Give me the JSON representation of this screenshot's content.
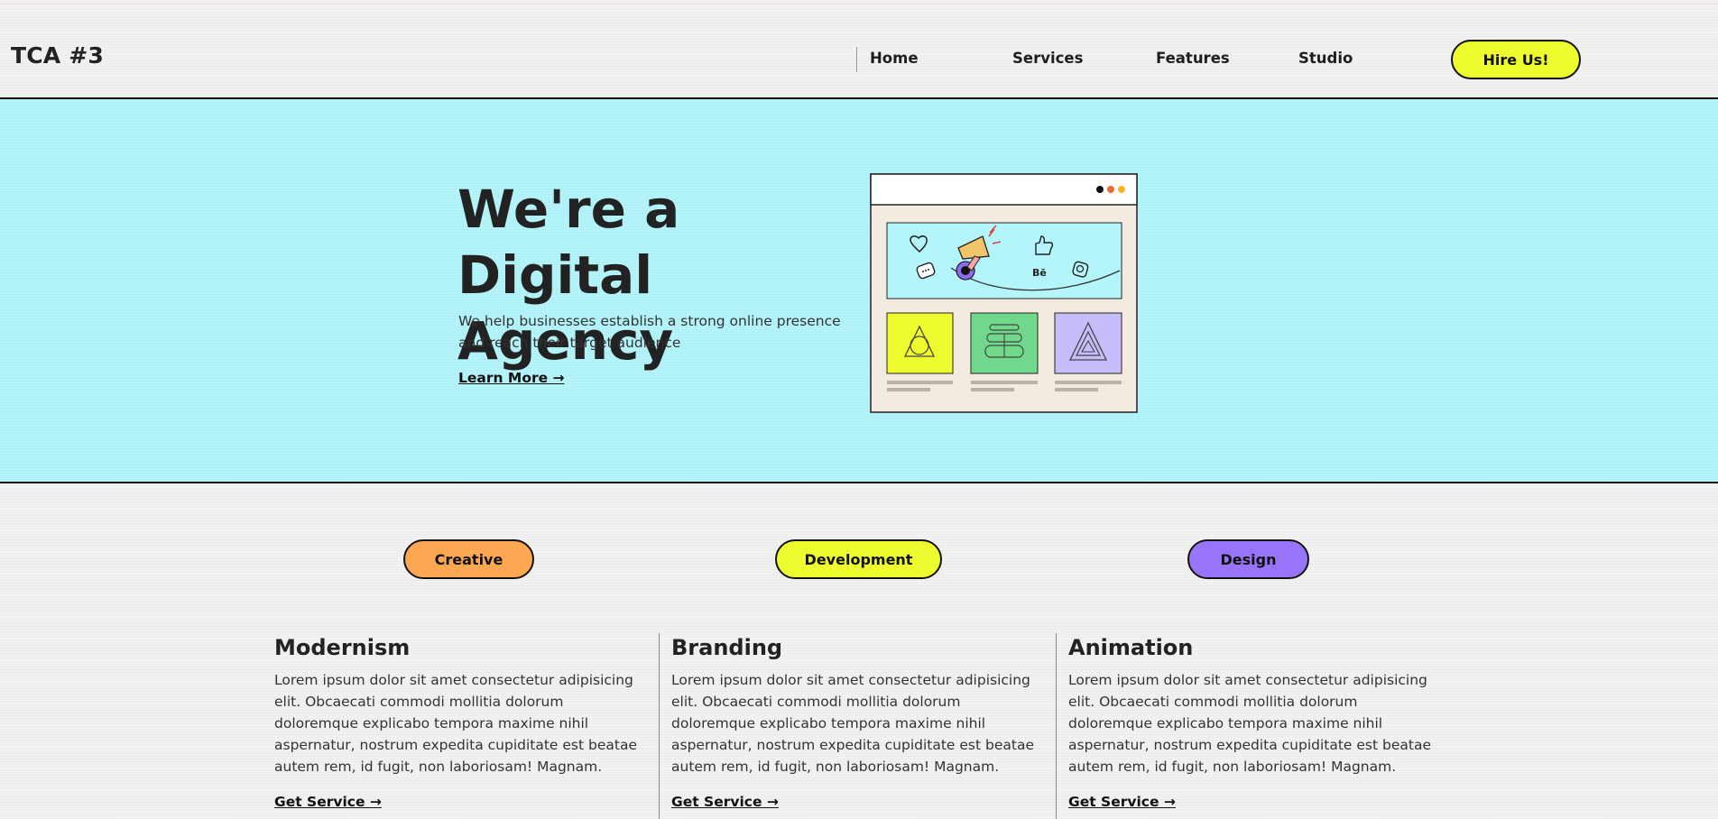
{
  "header": {
    "logo": "TCA #3",
    "nav": [
      "Home",
      "Services",
      "Features",
      "Studio"
    ],
    "cta_label": "Hire Us!"
  },
  "hero": {
    "title": "We're a Digital Agency",
    "subtitle": "We help businesses establish a strong online presence and reach their target audience",
    "link_label": "Learn More →"
  },
  "categories": [
    "Creative",
    "Development",
    "Design"
  ],
  "cards": [
    {
      "title": "Modernism",
      "body": "Lorem ipsum dolor sit amet consectetur adipisicing elit. Obcaecati commodi mollitia dolorum doloremque explicabo tempora maxime nihil aspernatur, nostrum expedita cupiditate est beatae autem rem, id fugit, non laboriosam! Magnam.",
      "link_label": "Get Service →"
    },
    {
      "title": "Branding",
      "body": "Lorem ipsum dolor sit amet consectetur adipisicing elit. Obcaecati commodi mollitia dolorum doloremque explicabo tempora maxime nihil aspernatur, nostrum expedita cupiditate est beatae autem rem, id fugit, non laboriosam! Magnam.",
      "link_label": "Get Service →"
    },
    {
      "title": "Animation",
      "body": "Lorem ipsum dolor sit amet consectetur adipisicing elit. Obcaecati commodi mollitia dolorum doloremque explicabo tempora maxime nihil aspernatur, nostrum expedita cupiditate est beatae autem rem, id fugit, non laboriosam! Magnam.",
      "link_label": "Get Service →"
    }
  ],
  "illustration": {
    "behance_label": "Bē",
    "icons": [
      "heart-icon",
      "chat-icon",
      "megaphone-icon",
      "thumbs-up-icon",
      "instagram-icon",
      "triangle-icon",
      "stack-icon",
      "nested-triangle-icon"
    ]
  },
  "colors": {
    "hero_bg": "#b4f5fb",
    "yellow": "#eefc2f",
    "orange": "#fca853",
    "purple": "#9874f8",
    "green": "#6fd88a",
    "lavender": "#c8bdfb",
    "paper": "#f3ebdf",
    "ink": "#111111"
  }
}
